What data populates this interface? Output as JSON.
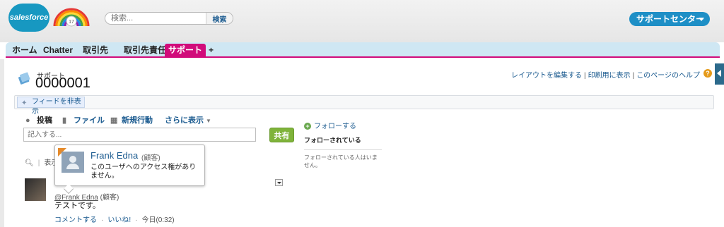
{
  "header": {
    "logo_text": "salesforce",
    "rainbow_badge": "17",
    "search_placeholder": "検索...",
    "search_button": "検索",
    "app_menu": "サポートセンター"
  },
  "tabs": [
    {
      "label": "ホーム"
    },
    {
      "label": "Chatter"
    },
    {
      "label": "取引先"
    },
    {
      "label": "取引先責任者"
    },
    {
      "label": "サポート",
      "active": true
    },
    {
      "label": "+"
    }
  ],
  "record": {
    "type_label": "サポート",
    "number": "0000001"
  },
  "help_links": {
    "edit_layout": "レイアウトを編集する",
    "print": "印刷用に表示",
    "help": "このページのヘルプ"
  },
  "feed": {
    "toggle_label": "フィードを非表示",
    "publisher_tabs": {
      "post": "投稿",
      "file": "ファイル",
      "new_action": "新規行動",
      "more": "さらに表示"
    },
    "compose_placeholder": "記入する...",
    "share_button": "共有",
    "filter_label": "表示"
  },
  "post": {
    "author": "@Frank Edna",
    "author_role": "(顧客)",
    "text": "テストです。",
    "comment": "コメントする",
    "like": "いいね!",
    "timestamp": "今日(0:32)"
  },
  "hovercard": {
    "name": "Frank Edna",
    "role": "(顧客)",
    "message": "このユーザへのアクセス権がありません。"
  },
  "followers": {
    "follow_link": "フォローする",
    "title": "フォローされている",
    "empty": "フォローされている人はいません。"
  },
  "colors": {
    "brand_blue": "#1798c1",
    "active_tab": "#d10b7a",
    "share_green": "#7fb33a",
    "link": "#1a5a8f"
  }
}
